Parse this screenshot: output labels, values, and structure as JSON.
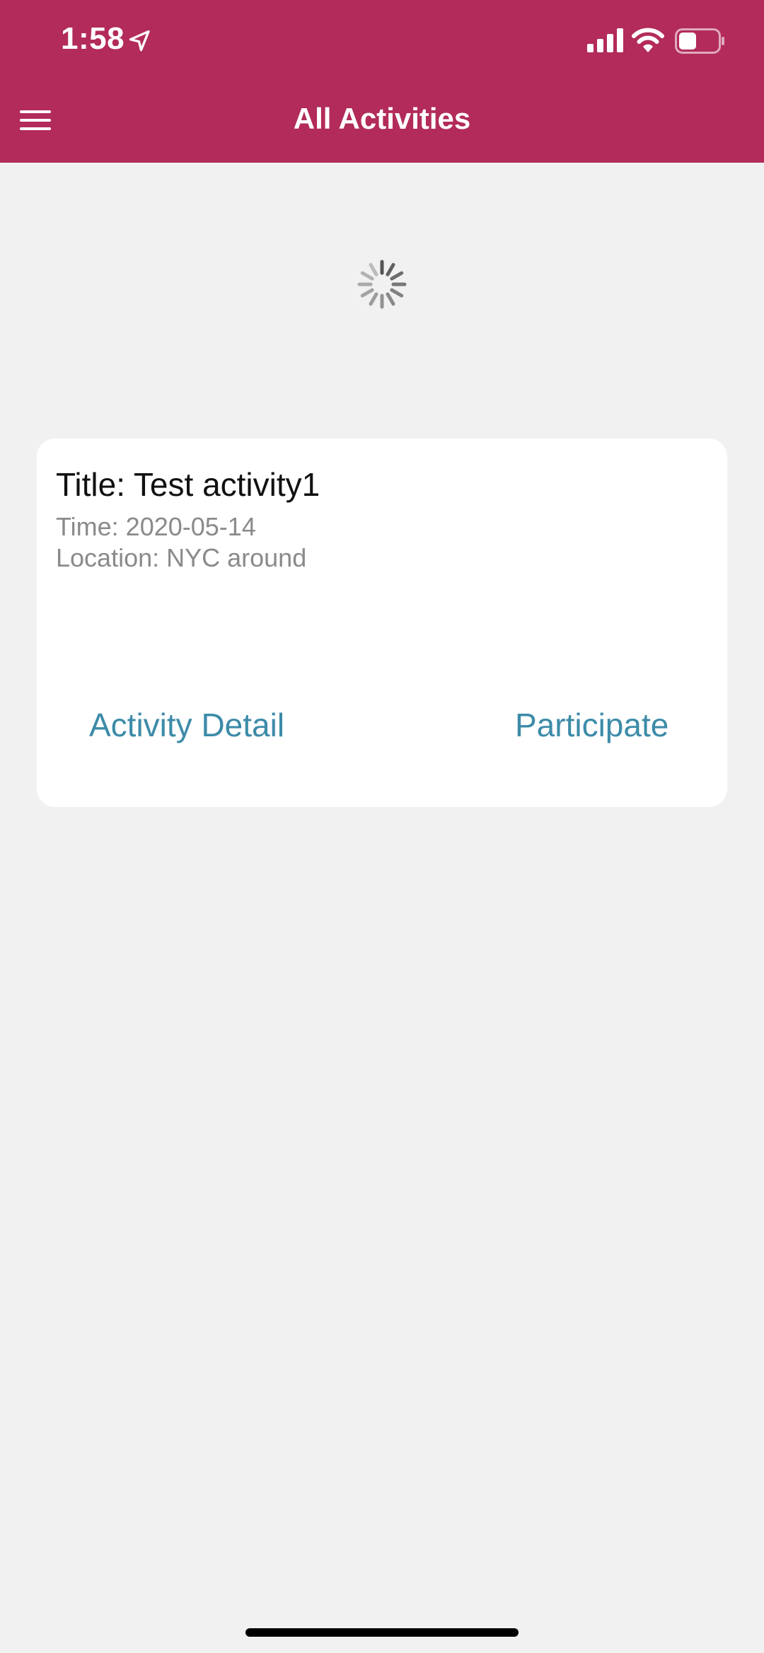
{
  "status_bar": {
    "time": "1:58",
    "icons": [
      "location-arrow-icon",
      "cellular-signal-icon",
      "wifi-icon",
      "battery-icon"
    ]
  },
  "header": {
    "title": "All Activities",
    "menu_icon": "hamburger-menu-icon",
    "background_color": "#b22b5a"
  },
  "loading": {
    "icon": "loading-spinner-icon"
  },
  "activities": [
    {
      "title": "Title: Test activity1",
      "time": "Time: 2020-05-14",
      "location": "Location: NYC around",
      "detail_label": "Activity Detail",
      "participate_label": "Participate"
    }
  ],
  "colors": {
    "accent": "#3c8ba8",
    "page_background": "#f1f1f1"
  }
}
